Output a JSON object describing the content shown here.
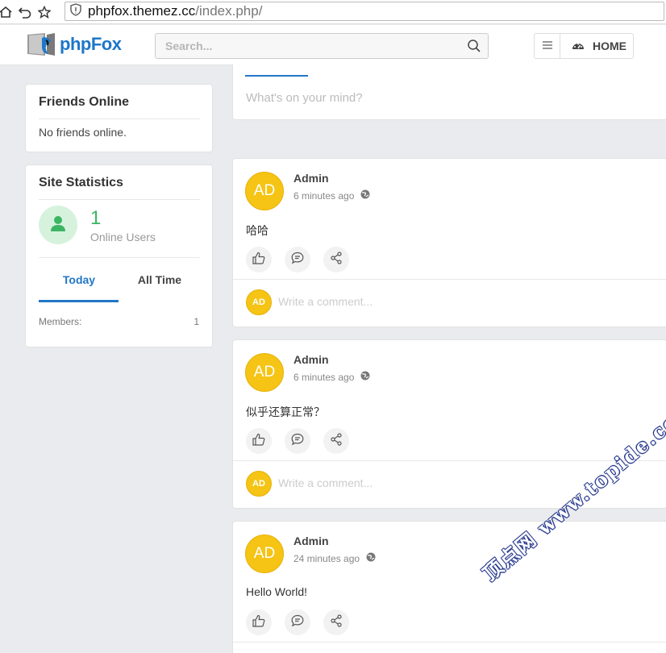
{
  "browser": {
    "url_host": "phpfox.themez.cc",
    "url_path": "/index.php/"
  },
  "header": {
    "logo_text": "phpFox",
    "search_placeholder": "Search...",
    "home_label": "HOME"
  },
  "friends_online": {
    "title": "Friends Online",
    "empty_text": "No friends online."
  },
  "site_statistics": {
    "title": "Site Statistics",
    "online_count": "1",
    "online_label": "Online Users",
    "tabs": [
      {
        "label": "Today",
        "active": true
      },
      {
        "label": "All Time",
        "active": false
      }
    ],
    "members_label": "Members:",
    "members_value": "1"
  },
  "composer": {
    "placeholder": "What's on your mind?"
  },
  "posts": [
    {
      "avatar": "AD",
      "author": "Admin",
      "time": "6 minutes ago",
      "body": "哈哈",
      "comment_avatar": "AD",
      "comment_placeholder": "Write a comment..."
    },
    {
      "avatar": "AD",
      "author": "Admin",
      "time": "6 minutes ago",
      "body": "似乎还算正常？",
      "comment_avatar": "AD",
      "comment_placeholder": "Write a comment..."
    },
    {
      "avatar": "AD",
      "author": "Admin",
      "time": "24 minutes ago",
      "body": "Hello World!"
    }
  ],
  "watermark": "顶点网 www.topide.com",
  "colors": {
    "accent": "#2276c8",
    "avatar": "#f5c414",
    "online": "#3cb563",
    "background": "#e9ebee"
  }
}
